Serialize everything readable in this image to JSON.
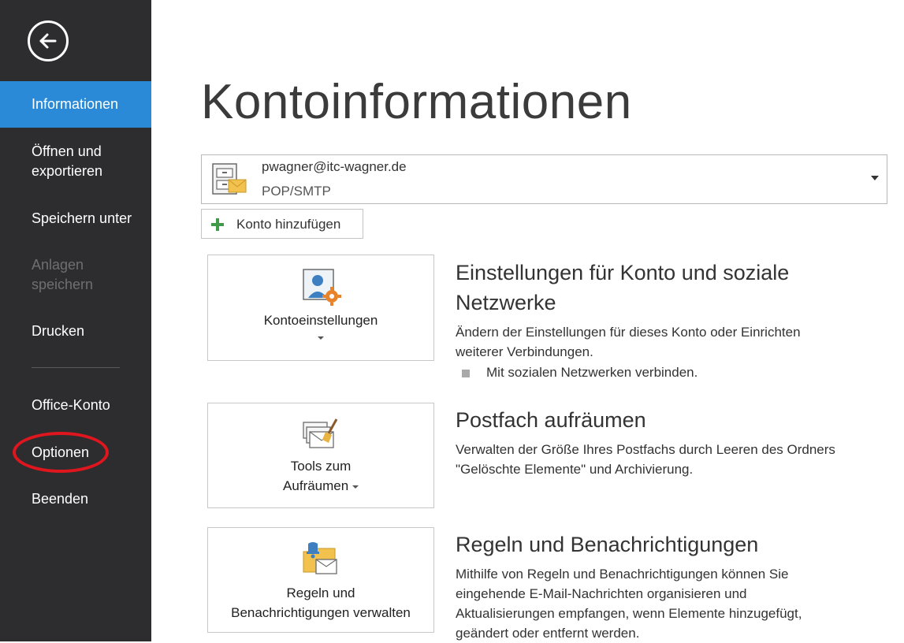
{
  "sidebar": {
    "items": [
      {
        "label": "Informationen"
      },
      {
        "label": "Öffnen und exportieren"
      },
      {
        "label": "Speichern unter"
      },
      {
        "label": "Anlagen speichern"
      },
      {
        "label": "Drucken"
      },
      {
        "label": "Office-Konto"
      },
      {
        "label": "Optionen"
      },
      {
        "label": "Beenden"
      }
    ]
  },
  "main": {
    "title": "Kontoinformationen",
    "account": {
      "email": "pwagner@itc-wagner.de",
      "type": "POP/SMTP"
    },
    "add_account_label": "Konto hinzufügen",
    "sections": [
      {
        "tile_line1": "Kontoeinstellungen",
        "title_line1": "Einstellungen für Konto und soziale",
        "title_line2": "Netzwerke",
        "desc_line1": "Ändern der Einstellungen für dieses Konto oder Einrichten",
        "desc_line2": "weiterer Verbindungen.",
        "bullet": "Mit sozialen Netzwerken verbinden."
      },
      {
        "tile_line1": "Tools zum",
        "tile_line2": "Aufräumen",
        "title_line1": "Postfach aufräumen",
        "desc_line1": "Verwalten der Größe Ihres Postfachs durch Leeren des Ordners",
        "desc_line2": "\"Gelöschte Elemente\" und Archivierung."
      },
      {
        "tile_line1": "Regeln und",
        "tile_line2": "Benachrichtigungen verwalten",
        "title_line1": "Regeln und Benachrichtigungen",
        "desc_line1": "Mithilfe von Regeln und Benachrichtigungen können Sie",
        "desc_line2": "eingehende E-Mail-Nachrichten organisieren und",
        "desc_line3": "Aktualisierungen empfangen, wenn Elemente hinzugefügt,",
        "desc_line4": "geändert oder entfernt werden."
      }
    ]
  },
  "colors": {
    "sidebar_bg": "#2d2d2f",
    "active_item": "#2b8ad7",
    "highlight_ring": "#e0161e"
  }
}
